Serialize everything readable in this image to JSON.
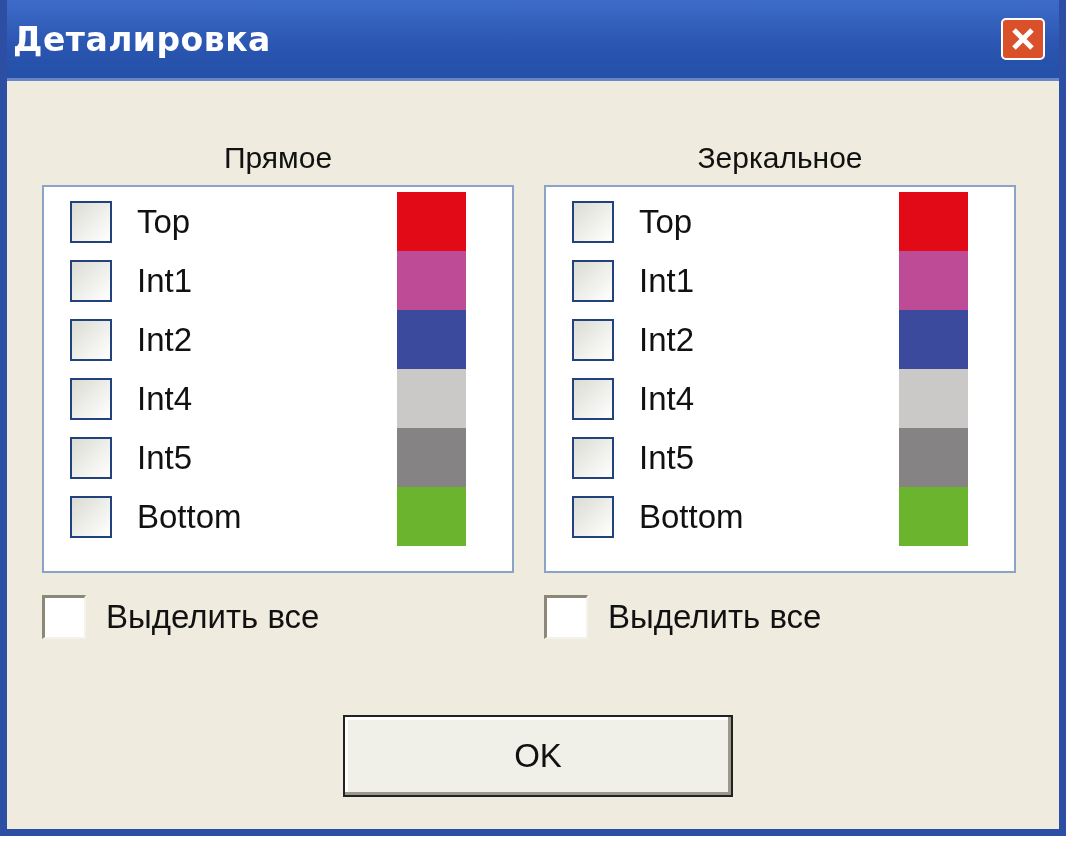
{
  "window": {
    "title": "Деталировка"
  },
  "panels": [
    {
      "heading": "Прямое",
      "items": [
        {
          "label": "Top",
          "checked": false,
          "color": "#e30a17"
        },
        {
          "label": "Int1",
          "checked": false,
          "color": "#bd4b96"
        },
        {
          "label": "Int2",
          "checked": false,
          "color": "#3c4a9e"
        },
        {
          "label": "Int4",
          "checked": false,
          "color": "#cbc8c8"
        },
        {
          "label": "Int5",
          "checked": false,
          "color": "#858384"
        },
        {
          "label": "Bottom",
          "checked": false,
          "color": "#6bb42d"
        }
      ],
      "select_all": {
        "label": "Выделить все",
        "checked": false
      }
    },
    {
      "heading": "Зеркальное",
      "items": [
        {
          "label": "Top",
          "checked": false,
          "color": "#e30a17"
        },
        {
          "label": "Int1",
          "checked": false,
          "color": "#bd4b96"
        },
        {
          "label": "Int2",
          "checked": false,
          "color": "#3c4a9e"
        },
        {
          "label": "Int4",
          "checked": false,
          "color": "#cbc8c8"
        },
        {
          "label": "Int5",
          "checked": false,
          "color": "#858384"
        },
        {
          "label": "Bottom",
          "checked": false,
          "color": "#6bb42d"
        }
      ],
      "select_all": {
        "label": "Выделить все",
        "checked": false
      }
    }
  ],
  "ok_button": "OK"
}
